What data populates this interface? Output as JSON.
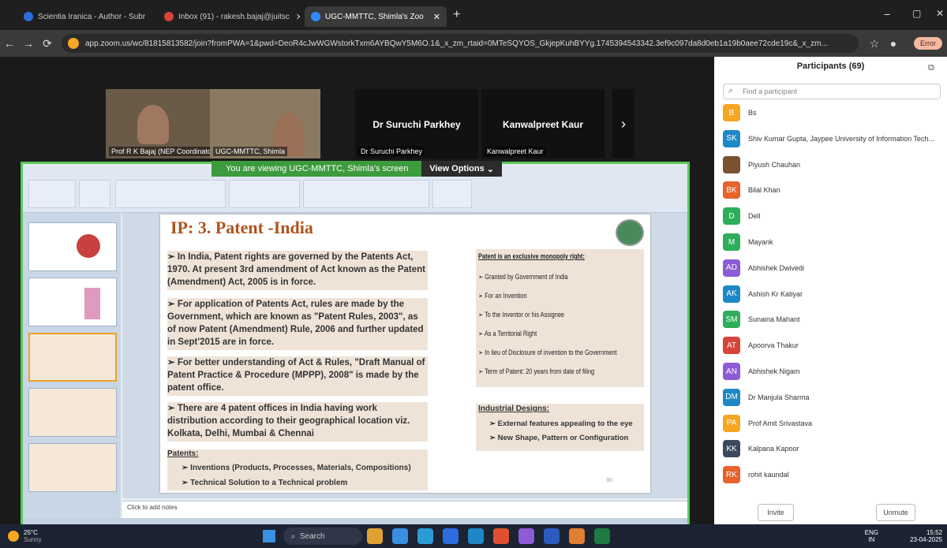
{
  "browser": {
    "tabs": [
      {
        "label": "Scientia Iranica - Author - Subr",
        "color": "#2d6cdf"
      },
      {
        "label": "Inbox (91) - rakesh.bajaj@juitsc",
        "color": "#d64538"
      },
      {
        "label": "UGC-MMTTC, Shimla's Zoo",
        "color": "#2d8cff"
      }
    ],
    "url": "app.zoom.us/wc/81815813582/join?fromPWA=1&pwd=DeoR4cJwWGWstorkTxm6AYBQwY5M6O.1&_x_zm_rtaid=0MTeSQYOS_GkjepKuhBYYg.1745394543342.3ef9c097da8d0eb1a19b0aee72cde19c&_x_zm...",
    "error_label": "Error"
  },
  "videos": [
    {
      "name": "Prof R K Bajaj (NEP Coordinator..."
    },
    {
      "name": "UGC-MMTTC, Shimla"
    },
    {
      "name": "Dr Suruchi Parkhey",
      "big": "Dr Suruchi Parkhey"
    },
    {
      "name": "Kanwalpreet Kaur",
      "big": "Kanwalpreet Kaur"
    }
  ],
  "share_banner": {
    "text": "You are viewing UGC-MMTTC, Shimla's screen",
    "options": "View Options"
  },
  "slide": {
    "title": "IP: 3. Patent -India",
    "paras": [
      "In India, Patent rights are governed by the Patents Act, 1970. At present 3rd amendment of Act known as the Patent (Amendment) Act, 2005 is in force.",
      "For application of Patents Act, rules are made by the Government, which are known as \"Patent Rules, 2003\", as of now Patent (Amendment) Rule, 2006 and further updated in Sept'2015 are in force.",
      "For better understanding of Act & Rules, \"Draft Manual of Patent Practice & Procedure (MPPP), 2008\" is made by the patent office.",
      "There are 4 patent offices in India having work distribution according to their geographical location viz. Kolkata, Delhi, Mumbai & Chennai"
    ],
    "monopoly_head": "Patent is an exclusive monopoly right:",
    "monopoly": [
      "Granted by Government of India",
      "For an Invention",
      "To the Inventor or his Assignee",
      "As a Territorial Right",
      "In lieu of Disclosure of invention to the Government",
      "Term of Patent: 20 years from date of filing"
    ],
    "industrial_head": "Industrial Designs:",
    "industrial": [
      "External features appealing to the eye",
      "New Shape, Pattern or Configuration"
    ],
    "patents_head": "Patents:",
    "patents": [
      "Inventions (Products, Processes, Materials, Compositions)",
      "Technical Solution to a Technical problem"
    ],
    "page_no": "30",
    "notes": "Click to add notes"
  },
  "participants": {
    "title": "Participants (69)",
    "search_placeholder": "Find a participant",
    "list": [
      {
        "initials": "B",
        "name": "Bs",
        "color": "#f5a623"
      },
      {
        "initials": "SK",
        "name": "Shiv Kumar Gupta, Jaypee University of Information Tech...",
        "color": "#1e88c7"
      },
      {
        "initials": "",
        "name": "Piyush Chauhan",
        "color": "#7a5230"
      },
      {
        "initials": "BK",
        "name": "Bilal Khan",
        "color": "#e8622c"
      },
      {
        "initials": "D",
        "name": "Dell",
        "color": "#2eae5a"
      },
      {
        "initials": "M",
        "name": "Mayank",
        "color": "#2eae5a"
      },
      {
        "initials": "AD",
        "name": "Abhishek Dwivedi",
        "color": "#8e5bd6"
      },
      {
        "initials": "AK",
        "name": "Ashish Kr Katiyar",
        "color": "#1e88c7"
      },
      {
        "initials": "SM",
        "name": "Sunaina Mahant",
        "color": "#2eae5a"
      },
      {
        "initials": "AT",
        "name": "Apoorva Thakur",
        "color": "#d64538"
      },
      {
        "initials": "AN",
        "name": "Abhishek Nigam",
        "color": "#8e5bd6"
      },
      {
        "initials": "DM",
        "name": "Dr Manjula Sharma",
        "color": "#1e88c7"
      },
      {
        "initials": "PA",
        "name": "Prof Amit Srivastava",
        "color": "#f5a623"
      },
      {
        "initials": "KK",
        "name": "Kalpana Kapoor",
        "color": "#3a4a5e"
      },
      {
        "initials": "RK",
        "name": "rohit kaundal",
        "color": "#e8622c"
      }
    ],
    "invite": "Invite",
    "unmute": "Unmute"
  },
  "taskbar": {
    "temp": "25°C",
    "weather": "Sunny",
    "search": "Search",
    "lang": "ENG",
    "region": "IN",
    "time": "15:52",
    "date": "23-04-2025"
  }
}
